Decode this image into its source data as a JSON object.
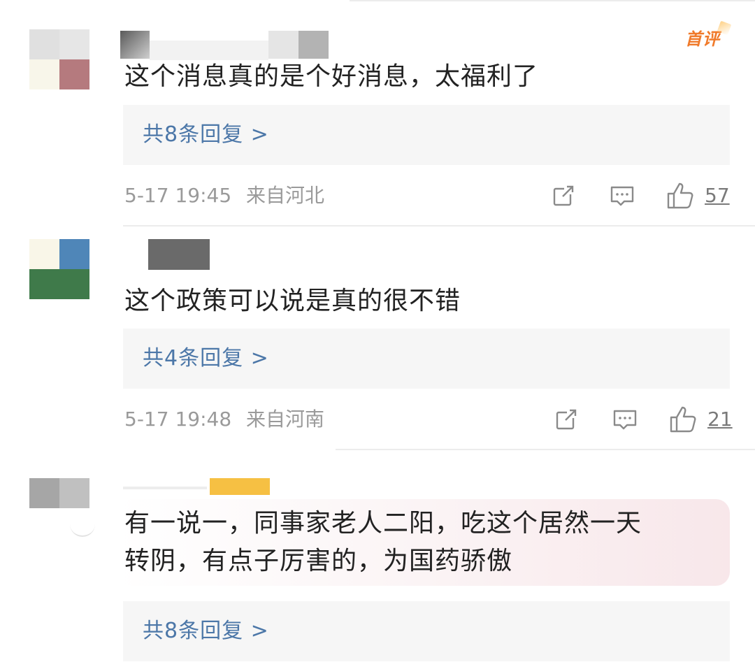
{
  "comments": [
    {
      "badge": "首评",
      "text": "这个消息真的是个好消息，太福利了",
      "reply_link": "共8条回复 >",
      "timestamp": "5-17 19:45",
      "location": "来自河北",
      "likes": "57"
    },
    {
      "text": "这个政策可以说是真的很不错",
      "reply_link": "共4条回复 >",
      "timestamp": "5-17 19:48",
      "location": "来自河南",
      "likes": "21"
    },
    {
      "text_line1": "有一说一，同事家老人二阳，吃这个居然一天",
      "text_line2": "转阴，有点子厉害的，为国药骄傲",
      "reply_link": "共8条回复 >"
    }
  ],
  "icons": {
    "share": "share-icon",
    "comment": "comment-icon",
    "like": "thumbs-up-icon"
  },
  "colors": {
    "link": "#4c77a8",
    "badge": "#f07a2a",
    "meta": "#9a9a9a"
  }
}
